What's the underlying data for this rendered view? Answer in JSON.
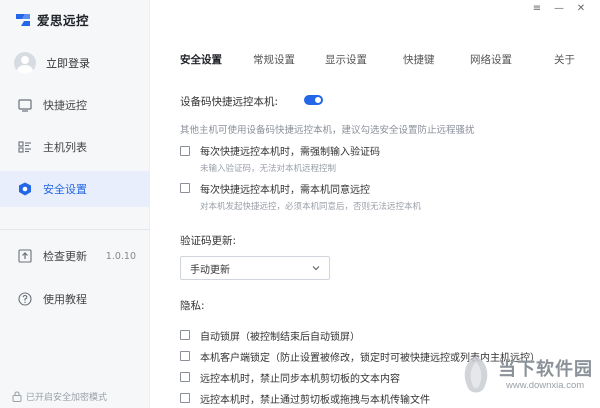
{
  "app": {
    "name": "爱思远控",
    "brand_color": "#2466e8"
  },
  "window_controls": {
    "menu": "≡",
    "minimize": "—",
    "close": "✕"
  },
  "sidebar": {
    "login_label": "立即登录",
    "items": [
      {
        "label": "快捷远控",
        "icon": "monitor-icon"
      },
      {
        "label": "主机列表",
        "icon": "list-icon"
      },
      {
        "label": "安全设置",
        "icon": "shield-icon",
        "active": true
      },
      {
        "label": "检查更新",
        "icon": "upload-icon",
        "version": "1.0.10"
      },
      {
        "label": "使用教程",
        "icon": "help-icon"
      }
    ],
    "footer_note": "已开启安全加密模式"
  },
  "tabs": [
    {
      "label": "安全设置",
      "active": true
    },
    {
      "label": "常规设置"
    },
    {
      "label": "显示设置"
    },
    {
      "label": "快捷键"
    },
    {
      "label": "网络设置"
    },
    {
      "label": "关于"
    }
  ],
  "security": {
    "device_code_label": "设备码快捷远控本机:",
    "device_code_enabled": true,
    "device_code_hint": "其他主机可使用设备码快捷远控本机，建议勾选安全设置防止远程骚扰",
    "options": [
      {
        "label": "每次快捷远控本机时，需强制输入验证码",
        "sub": "未输入验证码，无法对本机远程控制",
        "checked": false
      },
      {
        "label": "每次快捷远控本机时，需本机同意远控",
        "sub": "对本机发起快捷远控，必须本机同意后，否则无法远控本机",
        "checked": false
      }
    ],
    "code_update_label": "验证码更新:",
    "code_update_value": "手动更新",
    "privacy_label": "隐私:",
    "privacy_options": [
      {
        "label": "自动锁屏（被控制结束后自动锁屏）",
        "checked": false
      },
      {
        "label": "本机客户端锁定（防止设置被修改，锁定时可被快捷远控或列表内主机远控）",
        "checked": false
      },
      {
        "label": "远控本机时，禁止同步本机剪切板的文本内容",
        "checked": false
      },
      {
        "label": "远控本机时，禁止通过剪切板或拖拽与本机传输文件",
        "checked": false
      }
    ]
  },
  "watermark": {
    "text": "当下软件园",
    "url": "www.downxia.com"
  }
}
